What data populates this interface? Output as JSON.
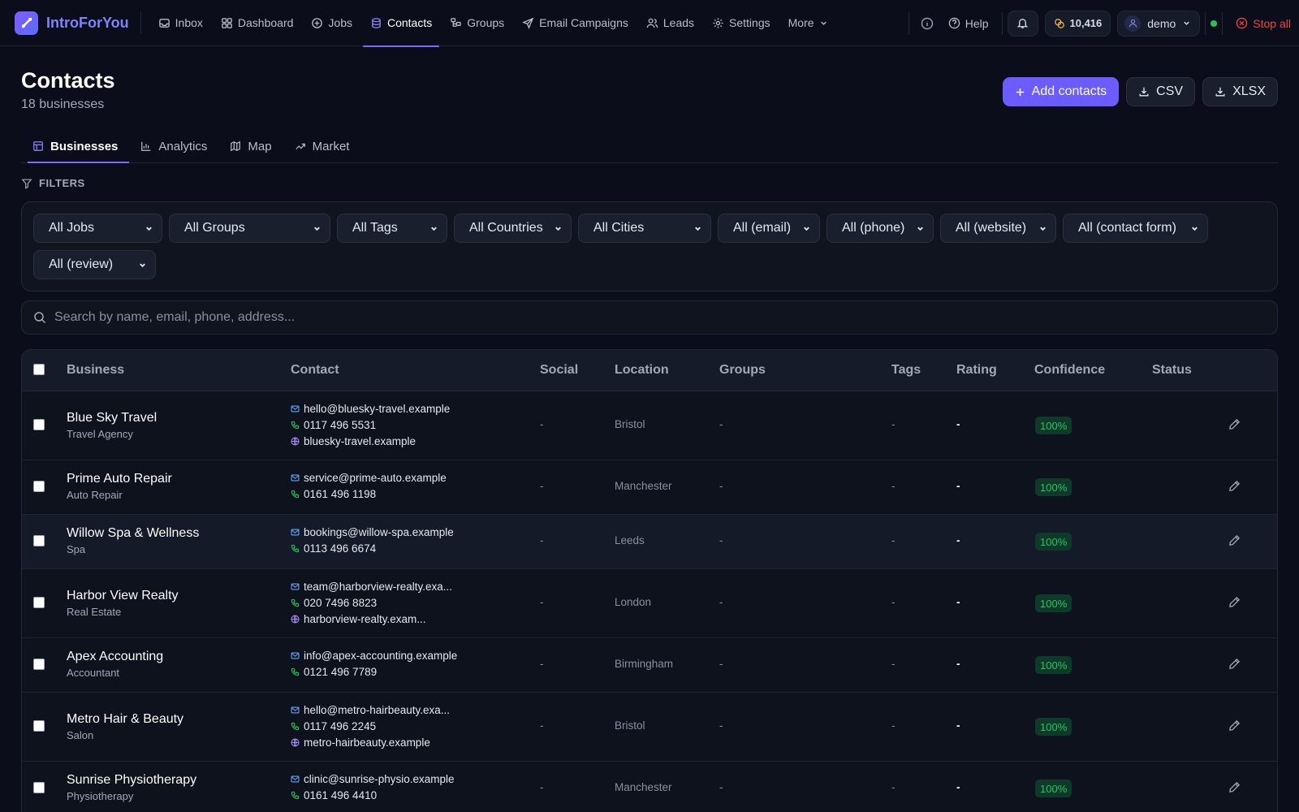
{
  "app": {
    "name": "IntroForYou"
  },
  "nav": {
    "items": [
      {
        "label": "Inbox",
        "icon": "inbox-icon"
      },
      {
        "label": "Dashboard",
        "icon": "dashboard-icon"
      },
      {
        "label": "Jobs",
        "icon": "plus-circle-icon"
      },
      {
        "label": "Contacts",
        "icon": "database-icon",
        "active": true
      },
      {
        "label": "Groups",
        "icon": "groups-icon"
      },
      {
        "label": "Email Campaigns",
        "icon": "send-icon"
      },
      {
        "label": "Leads",
        "icon": "users-icon"
      },
      {
        "label": "Settings",
        "icon": "gear-icon"
      },
      {
        "label": "More",
        "icon": "chevron-down-icon"
      }
    ],
    "help_label": "Help",
    "credits": "10,416",
    "user": "demo",
    "stop_label": "Stop all"
  },
  "page": {
    "title": "Contacts",
    "subtitle": "18 businesses",
    "actions": {
      "add": "Add contacts",
      "csv": "CSV",
      "xlsx": "XLSX"
    },
    "tabs": [
      "Businesses",
      "Analytics",
      "Map",
      "Market"
    ],
    "filters_label": "FILTERS",
    "filters": [
      "All Jobs",
      "All Groups",
      "All Tags",
      "All Countries",
      "All Cities",
      "All (email)",
      "All (phone)",
      "All (website)",
      "All (contact form)",
      "All (review)"
    ],
    "search_placeholder": "Search by name, email, phone, address..."
  },
  "table": {
    "columns": [
      "Business",
      "Contact",
      "Social",
      "Location",
      "Groups",
      "Tags",
      "Rating",
      "Confidence",
      "Status"
    ],
    "rows": [
      {
        "name": "Blue Sky Travel",
        "type": "Travel Agency",
        "email": "hello@bluesky-travel.example",
        "phone": "0117 496 5531",
        "website": "bluesky-travel.example",
        "social": "-",
        "location": "Bristol",
        "groups": "-",
        "tags": "-",
        "rating": "-",
        "confidence": "100%"
      },
      {
        "name": "Prime Auto Repair",
        "type": "Auto Repair",
        "email": "service@prime-auto.example",
        "phone": "0161 496 1198",
        "social": "-",
        "location": "Manchester",
        "groups": "-",
        "tags": "-",
        "rating": "-",
        "confidence": "100%"
      },
      {
        "name": "Willow Spa & Wellness",
        "type": "Spa",
        "email": "bookings@willow-spa.example",
        "phone": "0113 496 6674",
        "social": "-",
        "location": "Leeds",
        "groups": "-",
        "tags": "-",
        "rating": "-",
        "confidence": "100%"
      },
      {
        "name": "Harbor View Realty",
        "type": "Real Estate",
        "email": "team@harborview-realty.exa...",
        "phone": "020 7496 8823",
        "website": "harborview-realty.exam...",
        "social": "-",
        "location": "London",
        "groups": "-",
        "tags": "-",
        "rating": "-",
        "confidence": "100%"
      },
      {
        "name": "Apex Accounting",
        "type": "Accountant",
        "email": "info@apex-accounting.example",
        "phone": "0121 496 7789",
        "social": "-",
        "location": "Birmingham",
        "groups": "-",
        "tags": "-",
        "rating": "-",
        "confidence": "100%"
      },
      {
        "name": "Metro Hair & Beauty",
        "type": "Salon",
        "email": "hello@metro-hairbeauty.exa...",
        "phone": "0117 496 2245",
        "website": "metro-hairbeauty.example",
        "social": "-",
        "location": "Bristol",
        "groups": "-",
        "tags": "-",
        "rating": "-",
        "confidence": "100%"
      },
      {
        "name": "Sunrise Physiotherapy",
        "type": "Physiotherapy",
        "email": "clinic@sunrise-physio.example",
        "phone": "0161 496 4410",
        "social": "-",
        "location": "Manchester",
        "groups": "-",
        "tags": "-",
        "rating": "-",
        "confidence": "100%"
      }
    ]
  },
  "colors": {
    "accent": "#6a5cff",
    "background": "#0b0e1a",
    "success": "#22c55e",
    "danger": "#ef4444"
  }
}
